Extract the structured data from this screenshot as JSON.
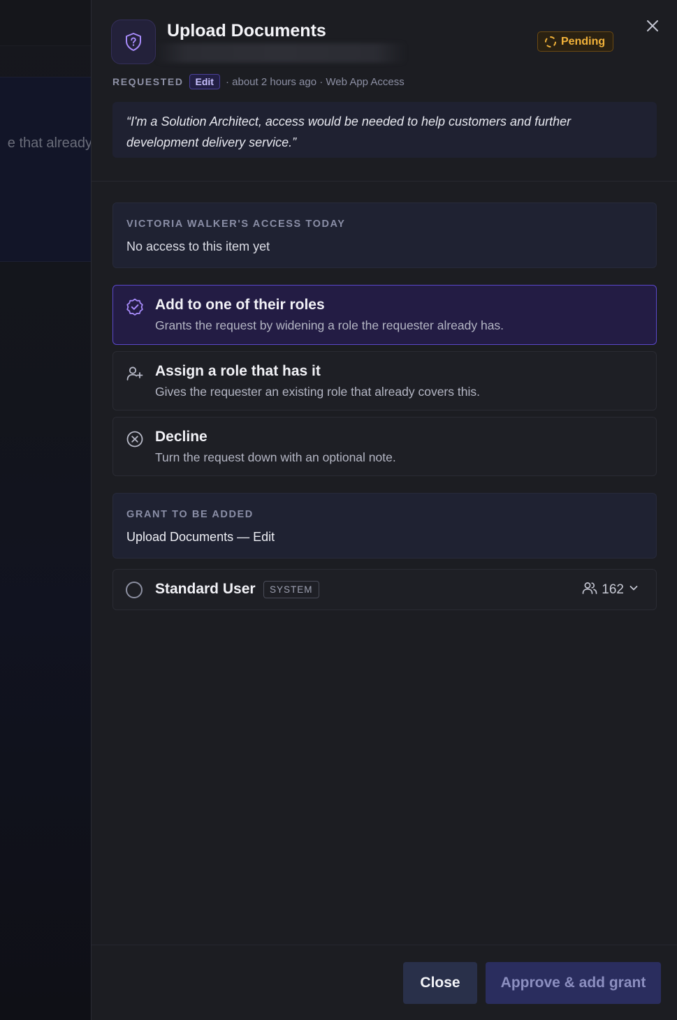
{
  "backdrop": {
    "visible_text": "e that already"
  },
  "header": {
    "title": "Upload Documents",
    "status": "Pending",
    "icon": "shield-question-icon",
    "close_icon": "close-icon"
  },
  "meta": {
    "requested_label": "REQUESTED",
    "permission_badge": "Edit",
    "time": "· about 2 hours ago · Web App Access"
  },
  "justification": "“I'm a Solution Architect, access would be needed to help customers and further development delivery service.”",
  "access_today": {
    "label": "VICTORIA WALKER'S ACCESS TODAY",
    "value": "No access to this item yet"
  },
  "options": [
    {
      "title": "Add to one of their roles",
      "description": "Grants the request by widening a role the requester already has.",
      "icon": "check-badge-icon",
      "selected": true
    },
    {
      "title": "Assign a role that has it",
      "description": "Gives the requester an existing role that already covers this.",
      "icon": "user-plus-icon",
      "selected": false
    },
    {
      "title": "Decline",
      "description": "Turn the request down with an optional note.",
      "icon": "x-circle-icon",
      "selected": false
    }
  ],
  "grant": {
    "label": "GRANT TO BE ADDED",
    "value": "Upload Documents — Edit"
  },
  "role": {
    "name": "Standard User",
    "tag": "SYSTEM",
    "member_count": "162",
    "icon": "users-icon"
  },
  "footer": {
    "close_label": "Close",
    "approve_label": "Approve & add grant"
  },
  "colors": {
    "accent": "#5a48c9",
    "pending": "#f3b33a",
    "panel": "#1c1d22"
  }
}
